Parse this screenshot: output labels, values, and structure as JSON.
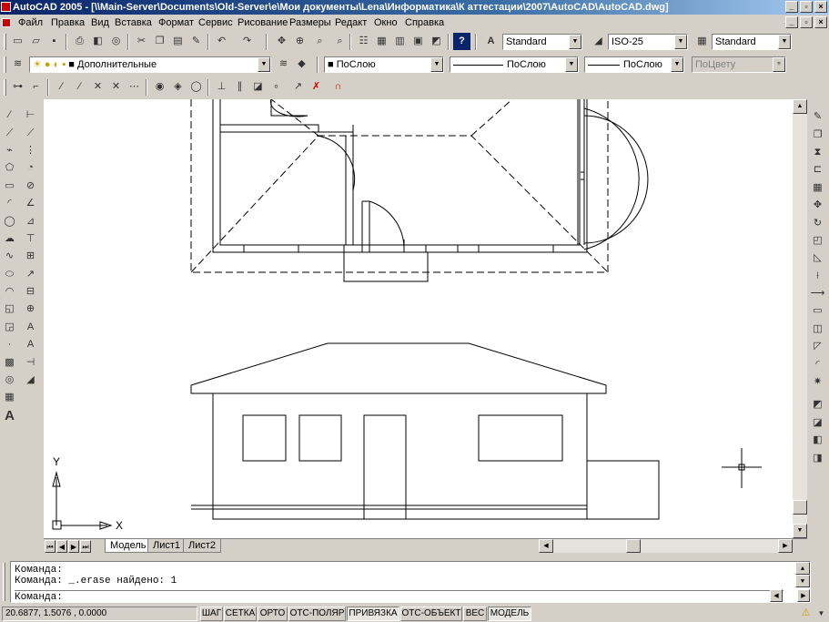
{
  "window": {
    "title": "AutoCAD 2005 - [\\\\Main-Server\\Documents\\Old-Server\\e\\Мои документы\\Lena\\Информатика\\К аттестации\\2007\\AutoCAD\\AutoCAD.dwg]"
  },
  "menu": {
    "items": [
      "Файл",
      "Правка",
      "Вид",
      "Вставка",
      "Формат",
      "Сервис",
      "Рисование",
      "Размеры",
      "Редакт",
      "Окно",
      "Справка"
    ]
  },
  "styles": {
    "text_style": "Standard",
    "dim_style": "ISO-25",
    "table_style": "Standard"
  },
  "layers": {
    "current_layer": "Дополнительные",
    "color": "ПоСлою",
    "linetype": "ПоСлою",
    "lineweight": "ПоСлою",
    "plotstyle": "ПоЦвету"
  },
  "ucs": {
    "x_label": "X",
    "y_label": "Y"
  },
  "tabs": [
    "Модель",
    "Лист1",
    "Лист2"
  ],
  "command": {
    "lines": [
      "Команда:",
      "Команда: _.erase найдено: 1"
    ],
    "prompt": "Команда:"
  },
  "status": {
    "coords": "20.6877, 1.5076 , 0.0000",
    "toggles": [
      {
        "label": "ШАГ",
        "on": false
      },
      {
        "label": "СЕТКА",
        "on": false
      },
      {
        "label": "ОРТО",
        "on": false
      },
      {
        "label": "ОТС-ПОЛЯР",
        "on": false
      },
      {
        "label": "ПРИВЯЗКА",
        "on": true
      },
      {
        "label": "ОТС-ОБЪЕКТ",
        "on": false
      },
      {
        "label": "ВЕС",
        "on": false
      },
      {
        "label": "МОДЕЛЬ",
        "on": true
      }
    ]
  },
  "colors": {
    "titlebar_start": "#0a246a",
    "titlebar_end": "#a6caf0",
    "face": "#d4d0c8"
  }
}
